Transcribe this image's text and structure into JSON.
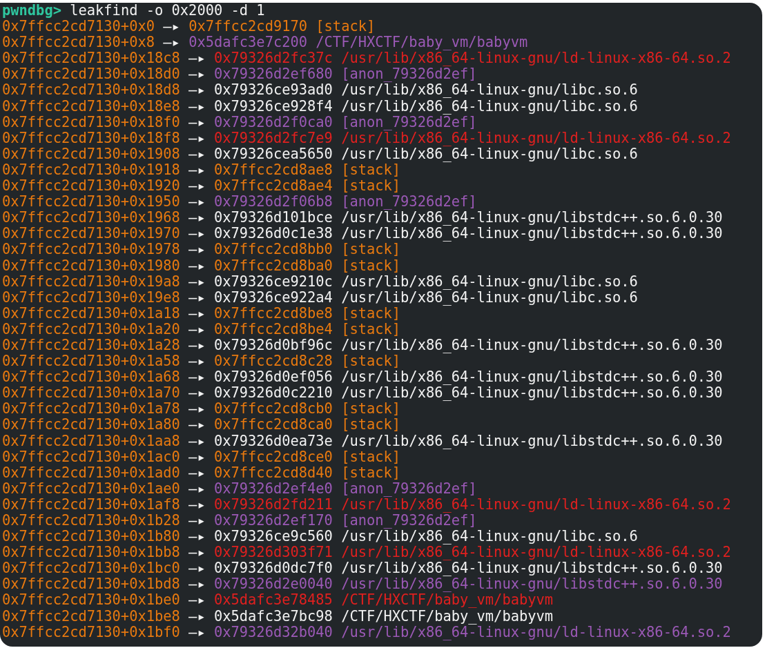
{
  "prompt": {
    "label": "pwndbg>",
    "command": "leakfind -o 0x2000 -d 1"
  },
  "rows": [
    {
      "source": "0x7ffcc2cd7130+0x0",
      "arrow": "—▸",
      "address": "0x7ffcc2cd9170",
      "mapping": "[stack]",
      "color": "#e8790f"
    },
    {
      "source": "0x7ffcc2cd7130+0x8",
      "arrow": "—▸",
      "address": "0x5dafc3e7c200",
      "mapping": "/CTF/HXCTF/baby_vm/babyvm",
      "color": "#9b59b6"
    },
    {
      "source": "0x7ffcc2cd7130+0x18c8",
      "arrow": "—▸",
      "address": "0x79326d2fc37c",
      "mapping": "/usr/lib/x86_64-linux-gnu/ld-linux-x86-64.so.2",
      "color": "#e0201f"
    },
    {
      "source": "0x7ffcc2cd7130+0x18d0",
      "arrow": "—▸",
      "address": "0x79326d2ef680",
      "mapping": "[anon_79326d2ef]",
      "color": "#9b59b6"
    },
    {
      "source": "0x7ffcc2cd7130+0x18d8",
      "arrow": "—▸",
      "address": "0x79326ce93ad0",
      "mapping": "/usr/lib/x86_64-linux-gnu/libc.so.6",
      "color": "#f2f2f2"
    },
    {
      "source": "0x7ffcc2cd7130+0x18e8",
      "arrow": "—▸",
      "address": "0x79326ce928f4",
      "mapping": "/usr/lib/x86_64-linux-gnu/libc.so.6",
      "color": "#f2f2f2"
    },
    {
      "source": "0x7ffcc2cd7130+0x18f0",
      "arrow": "—▸",
      "address": "0x79326d2f0ca0",
      "mapping": "[anon_79326d2ef]",
      "color": "#9b59b6"
    },
    {
      "source": "0x7ffcc2cd7130+0x18f8",
      "arrow": "—▸",
      "address": "0x79326d2fc7e9",
      "mapping": "/usr/lib/x86_64-linux-gnu/ld-linux-x86-64.so.2",
      "color": "#e0201f"
    },
    {
      "source": "0x7ffcc2cd7130+0x1908",
      "arrow": "—▸",
      "address": "0x79326cea5650",
      "mapping": "/usr/lib/x86_64-linux-gnu/libc.so.6",
      "color": "#f2f2f2"
    },
    {
      "source": "0x7ffcc2cd7130+0x1918",
      "arrow": "—▸",
      "address": "0x7ffcc2cd8ae8",
      "mapping": "[stack]",
      "color": "#e8790f"
    },
    {
      "source": "0x7ffcc2cd7130+0x1920",
      "arrow": "—▸",
      "address": "0x7ffcc2cd8ae4",
      "mapping": "[stack]",
      "color": "#e8790f"
    },
    {
      "source": "0x7ffcc2cd7130+0x1950",
      "arrow": "—▸",
      "address": "0x79326d2f06b8",
      "mapping": "[anon_79326d2ef]",
      "color": "#9b59b6"
    },
    {
      "source": "0x7ffcc2cd7130+0x1968",
      "arrow": "—▸",
      "address": "0x79326d101bce",
      "mapping": "/usr/lib/x86_64-linux-gnu/libstdc++.so.6.0.30",
      "color": "#f2f2f2"
    },
    {
      "source": "0x7ffcc2cd7130+0x1970",
      "arrow": "—▸",
      "address": "0x79326d0c1e38",
      "mapping": "/usr/lib/x86_64-linux-gnu/libstdc++.so.6.0.30",
      "color": "#f2f2f2"
    },
    {
      "source": "0x7ffcc2cd7130+0x1978",
      "arrow": "—▸",
      "address": "0x7ffcc2cd8bb0",
      "mapping": "[stack]",
      "color": "#e8790f"
    },
    {
      "source": "0x7ffcc2cd7130+0x1980",
      "arrow": "—▸",
      "address": "0x7ffcc2cd8ba0",
      "mapping": "[stack]",
      "color": "#e8790f"
    },
    {
      "source": "0x7ffcc2cd7130+0x19a8",
      "arrow": "—▸",
      "address": "0x79326ce9210c",
      "mapping": "/usr/lib/x86_64-linux-gnu/libc.so.6",
      "color": "#f2f2f2"
    },
    {
      "source": "0x7ffcc2cd7130+0x19e8",
      "arrow": "—▸",
      "address": "0x79326ce922a4",
      "mapping": "/usr/lib/x86_64-linux-gnu/libc.so.6",
      "color": "#f2f2f2"
    },
    {
      "source": "0x7ffcc2cd7130+0x1a18",
      "arrow": "—▸",
      "address": "0x7ffcc2cd8be8",
      "mapping": "[stack]",
      "color": "#e8790f"
    },
    {
      "source": "0x7ffcc2cd7130+0x1a20",
      "arrow": "—▸",
      "address": "0x7ffcc2cd8be4",
      "mapping": "[stack]",
      "color": "#e8790f"
    },
    {
      "source": "0x7ffcc2cd7130+0x1a28",
      "arrow": "—▸",
      "address": "0x79326d0bf96c",
      "mapping": "/usr/lib/x86_64-linux-gnu/libstdc++.so.6.0.30",
      "color": "#f2f2f2"
    },
    {
      "source": "0x7ffcc2cd7130+0x1a58",
      "arrow": "—▸",
      "address": "0x7ffcc2cd8c28",
      "mapping": "[stack]",
      "color": "#e8790f"
    },
    {
      "source": "0x7ffcc2cd7130+0x1a68",
      "arrow": "—▸",
      "address": "0x79326d0ef056",
      "mapping": "/usr/lib/x86_64-linux-gnu/libstdc++.so.6.0.30",
      "color": "#f2f2f2"
    },
    {
      "source": "0x7ffcc2cd7130+0x1a70",
      "arrow": "—▸",
      "address": "0x79326d0c2210",
      "mapping": "/usr/lib/x86_64-linux-gnu/libstdc++.so.6.0.30",
      "color": "#f2f2f2"
    },
    {
      "source": "0x7ffcc2cd7130+0x1a78",
      "arrow": "—▸",
      "address": "0x7ffcc2cd8cb0",
      "mapping": "[stack]",
      "color": "#e8790f"
    },
    {
      "source": "0x7ffcc2cd7130+0x1a80",
      "arrow": "—▸",
      "address": "0x7ffcc2cd8ca0",
      "mapping": "[stack]",
      "color": "#e8790f"
    },
    {
      "source": "0x7ffcc2cd7130+0x1aa8",
      "arrow": "—▸",
      "address": "0x79326d0ea73e",
      "mapping": "/usr/lib/x86_64-linux-gnu/libstdc++.so.6.0.30",
      "color": "#f2f2f2"
    },
    {
      "source": "0x7ffcc2cd7130+0x1ac0",
      "arrow": "—▸",
      "address": "0x7ffcc2cd8ce0",
      "mapping": "[stack]",
      "color": "#e8790f"
    },
    {
      "source": "0x7ffcc2cd7130+0x1ad0",
      "arrow": "—▸",
      "address": "0x7ffcc2cd8d40",
      "mapping": "[stack]",
      "color": "#e8790f"
    },
    {
      "source": "0x7ffcc2cd7130+0x1ae0",
      "arrow": "—▸",
      "address": "0x79326d2ef4e0",
      "mapping": "[anon_79326d2ef]",
      "color": "#9b59b6"
    },
    {
      "source": "0x7ffcc2cd7130+0x1af8",
      "arrow": "—▸",
      "address": "0x79326d2fd211",
      "mapping": "/usr/lib/x86_64-linux-gnu/ld-linux-x86-64.so.2",
      "color": "#e0201f"
    },
    {
      "source": "0x7ffcc2cd7130+0x1b28",
      "arrow": "—▸",
      "address": "0x79326d2ef170",
      "mapping": "[anon_79326d2ef]",
      "color": "#9b59b6"
    },
    {
      "source": "0x7ffcc2cd7130+0x1b80",
      "arrow": "—▸",
      "address": "0x79326ce9c560",
      "mapping": "/usr/lib/x86_64-linux-gnu/libc.so.6",
      "color": "#f2f2f2"
    },
    {
      "source": "0x7ffcc2cd7130+0x1bb8",
      "arrow": "—▸",
      "address": "0x79326d303f71",
      "mapping": "/usr/lib/x86_64-linux-gnu/ld-linux-x86-64.so.2",
      "color": "#e0201f"
    },
    {
      "source": "0x7ffcc2cd7130+0x1bc0",
      "arrow": "—▸",
      "address": "0x79326d0dc7f0",
      "mapping": "/usr/lib/x86_64-linux-gnu/libstdc++.so.6.0.30",
      "color": "#f2f2f2"
    },
    {
      "source": "0x7ffcc2cd7130+0x1bd8",
      "arrow": "—▸",
      "address": "0x79326d2e0040",
      "mapping": "/usr/lib/x86_64-linux-gnu/libstdc++.so.6.0.30",
      "color": "#9b59b6"
    },
    {
      "source": "0x7ffcc2cd7130+0x1be0",
      "arrow": "—▸",
      "address": "0x5dafc3e78485",
      "mapping": "/CTF/HXCTF/baby_vm/babyvm",
      "color": "#e0201f"
    },
    {
      "source": "0x7ffcc2cd7130+0x1be8",
      "arrow": "—▸",
      "address": "0x5dafc3e7bc98",
      "mapping": "/CTF/HXCTF/baby_vm/babyvm",
      "color": "#f2f2f2"
    },
    {
      "source": "0x7ffcc2cd7130+0x1bf0",
      "arrow": "—▸",
      "address": "0x79326d32b040",
      "mapping": "/usr/lib/x86_64-linux-gnu/ld-linux-x86-64.so.2",
      "color": "#9b59b6"
    }
  ]
}
